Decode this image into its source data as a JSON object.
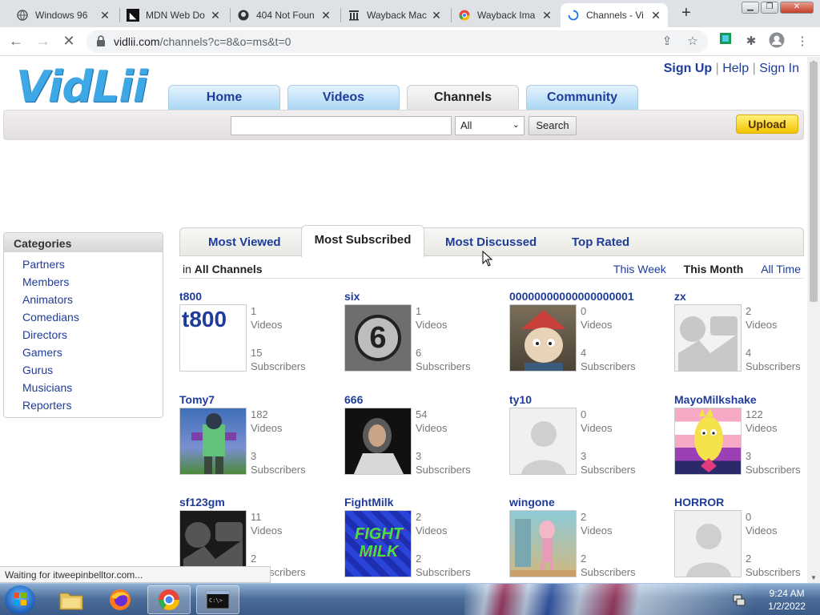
{
  "browser": {
    "tabs": [
      {
        "title": "Windows 96",
        "icon": "globe-icon"
      },
      {
        "title": "MDN Web Do",
        "icon": "mdn-icon"
      },
      {
        "title": "404 Not Foun",
        "icon": "github-icon"
      },
      {
        "title": "Wayback Mac",
        "icon": "archive-icon"
      },
      {
        "title": "Wayback Ima",
        "icon": "chrome-icon"
      },
      {
        "title": "Channels - Vi",
        "icon": "loading-icon"
      }
    ],
    "url_domain": "vidlii.com",
    "url_path": "/channels?c=8&o=ms&t=0",
    "status_text": "Waiting for itweepinbelltor.com..."
  },
  "site": {
    "logo": "VidLii",
    "top_links": {
      "sign_up": "Sign Up",
      "help": "Help",
      "sign_in": "Sign In",
      "sep": "|"
    },
    "nav": [
      "Home",
      "Videos",
      "Channels",
      "Community"
    ],
    "search": {
      "value": "",
      "scope": "All",
      "button": "Search"
    },
    "upload": "Upload"
  },
  "categories": {
    "title": "Categories",
    "items": [
      "Partners",
      "Members",
      "Animators",
      "Comedians",
      "Directors",
      "Gamers",
      "Gurus",
      "Musicians",
      "Reporters"
    ]
  },
  "channel_tabs": [
    "Most Viewed",
    "Most Subscribed",
    "Most Discussed",
    "Top Rated"
  ],
  "filter": {
    "prefix": "in",
    "scope": "All Channels",
    "periods": [
      "This Week",
      "This Month",
      "All Time"
    ]
  },
  "channels": [
    {
      "name": "t800",
      "videos": "1",
      "subscribers": "15",
      "thumb_text": "t800"
    },
    {
      "name": "six",
      "videos": "1",
      "subscribers": "6",
      "thumb_text": "6"
    },
    {
      "name": "00000000000000000001",
      "videos": "0",
      "subscribers": "4",
      "thumb_text": ""
    },
    {
      "name": "zx",
      "videos": "2",
      "subscribers": "4",
      "thumb_text": ""
    },
    {
      "name": "Tomy7",
      "videos": "182",
      "subscribers": "3",
      "thumb_text": ""
    },
    {
      "name": "666",
      "videos": "54",
      "subscribers": "3",
      "thumb_text": ""
    },
    {
      "name": "ty10",
      "videos": "0",
      "subscribers": "3",
      "thumb_text": ""
    },
    {
      "name": "MayoMilkshake",
      "videos": "122",
      "subscribers": "3",
      "thumb_text": ""
    },
    {
      "name": "sf123gm",
      "videos": "11",
      "subscribers": "2",
      "thumb_text": ""
    },
    {
      "name": "FightMilk",
      "videos": "2",
      "subscribers": "2",
      "thumb_text": "FIGHT MILK"
    },
    {
      "name": "wingone",
      "videos": "2",
      "subscribers": "2",
      "thumb_text": ""
    },
    {
      "name": "HORROR",
      "videos": "0",
      "subscribers": "2",
      "thumb_text": ""
    }
  ],
  "labels": {
    "videos": "Videos",
    "subscribers": "Subscribers"
  },
  "taskbar": {
    "time": "9:24 AM",
    "date": "1/2/2022"
  }
}
